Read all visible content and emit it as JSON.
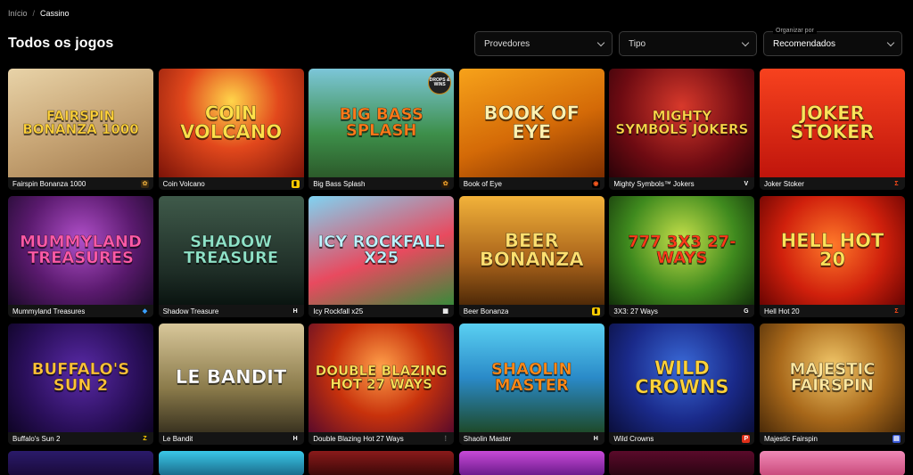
{
  "breadcrumb": {
    "home": "Início",
    "separator": "/",
    "current": "Cassino"
  },
  "page_title": "Todos os jogos",
  "filters": {
    "providers": "Provedores",
    "type": "Tipo",
    "sort_label": "Organizar por",
    "sort_value": "Recomendados"
  },
  "games": [
    {
      "name": "Fairspin Bonanza 1000",
      "logo": "FAIRSPIN BONANZA 1000",
      "bg": "linear-gradient(160deg,#e8d3a8 0%,#c9a777 50%,#a17a4d 100%)",
      "logo_color": "#ffd23a",
      "prov_bg": "#3a2a10",
      "prov_fg": "#d8a03a",
      "prov": "✿"
    },
    {
      "name": "Coin Volcano",
      "logo": "COIN VOLCANO",
      "bg": "radial-gradient(circle at 50% 30%,#ffd54a 0%,#e2481c 45%,#7a1308 100%)",
      "logo_color": "#ffe04a",
      "prov_bg": "#ffcc00",
      "prov_fg": "#000",
      "prov": "▮"
    },
    {
      "name": "Big Bass Splash",
      "logo": "BIG BASS SPLASH",
      "bg": "linear-gradient(180deg,#7cc6d9 0%,#3d8f4a 60%,#2c5a2a 100%)",
      "logo_color": "#ff7a1a",
      "prov_bg": "#2a1a08",
      "prov_fg": "#e39a2b",
      "prov": "✿",
      "badge": "DROPS & WINS"
    },
    {
      "name": "Book of Eye",
      "logo": "BOOK OF EYE",
      "bg": "linear-gradient(160deg,#f7a21a 0%,#d46a07 55%,#7d2d00 100%)",
      "logo_color": "#fff2b0",
      "prov_bg": "#000",
      "prov_fg": "#ff5a1f",
      "prov": "◉"
    },
    {
      "name": "Mighty Symbols™ Jokers",
      "logo": "MIGHTY SYMBOLS JOKERS",
      "bg": "radial-gradient(circle at 50% 35%,#d8392b 0%,#6e0b12 60%,#2a0208 100%)",
      "logo_color": "#ffd84a",
      "prov_bg": "#141414",
      "prov_fg": "#fff",
      "prov": "V"
    },
    {
      "name": "Joker Stoker",
      "logo": "JOKER STOKER",
      "bg": "linear-gradient(180deg,#f7421e 0%,#c0150c 100%)",
      "logo_color": "#ffe45a",
      "prov_bg": "#141414",
      "prov_fg": "#ff4b1a",
      "prov": "Σ"
    },
    {
      "name": "Mummyland Treasures",
      "logo": "MUMMYLAND TREASURES",
      "bg": "radial-gradient(circle at 50% 40%,#b04fc9 0%,#5a1a6e 55%,#1c0a2a 100%)",
      "logo_color": "#ff5aa8",
      "prov_bg": "#141414",
      "prov_fg": "#3aa0ff",
      "prov": "◆"
    },
    {
      "name": "Shadow Treasure",
      "logo": "SHADOW TREASURE",
      "bg": "linear-gradient(180deg,#3f5a4a 0%,#1e2d26 70%,#0a1410 100%)",
      "logo_color": "#8fe3c8",
      "prov_bg": "#141414",
      "prov_fg": "#fff",
      "prov": "H"
    },
    {
      "name": "Icy Rockfall x25",
      "logo": "ICY ROCKFALL X25",
      "bg": "linear-gradient(160deg,#7fd3f2 0%,#e84a5f 55%,#3a8a3a 100%)",
      "logo_color": "#bff3ff",
      "prov_bg": "#141414",
      "prov_fg": "#fff",
      "prov": "▦"
    },
    {
      "name": "Beer Bonanza",
      "logo": "BEER BONANZA",
      "bg": "linear-gradient(180deg,#f2b23a 0%,#a8621a 60%,#4f2a08 100%)",
      "logo_color": "#ffe070",
      "prov_bg": "#ffcc00",
      "prov_fg": "#000",
      "prov": "▮"
    },
    {
      "name": "3X3: 27 Ways",
      "logo": "777 3X3 27-WAYS",
      "bg": "radial-gradient(circle at 50% 40%,#c6e04a 0%,#3f8a1e 55%,#12300a 100%)",
      "logo_color": "#ff3a1a",
      "prov_bg": "#141414",
      "prov_fg": "#fff",
      "prov": "G"
    },
    {
      "name": "Hell Hot 20",
      "logo": "HELL HOT 20",
      "bg": "radial-gradient(circle at 50% 45%,#ff7a2a 0%,#d0200c 55%,#6a0402 100%)",
      "logo_color": "#ffe45a",
      "prov_bg": "#141414",
      "prov_fg": "#ff4b1a",
      "prov": "Σ"
    },
    {
      "name": "Buffalo's Sun 2",
      "logo": "BUFFALO'S SUN 2",
      "bg": "radial-gradient(circle at 50% 45%,#5a2aa8 0%,#2a0f5a 60%,#0e0424 100%)",
      "logo_color": "#ffc23a",
      "prov_bg": "#141414",
      "prov_fg": "#ffcc00",
      "prov": "Z"
    },
    {
      "name": "Le Bandit",
      "logo": "LE BANDIT",
      "bg": "linear-gradient(180deg,#d8c79a 0%,#8a7a4a 60%,#3a3320 100%)",
      "logo_color": "#ffffff",
      "prov_bg": "#141414",
      "prov_fg": "#fff",
      "prov": "H"
    },
    {
      "name": "Double Blazing Hot 27 Ways",
      "logo": "DOUBLE BLAZING HOT 27 WAYS",
      "bg": "radial-gradient(circle at 50% 40%,#ffa04a 0%,#c8320c 50%,#5a0a2a 100%)",
      "logo_color": "#ffe45a",
      "prov_bg": "#141414",
      "prov_fg": "#888",
      "prov": "⋮"
    },
    {
      "name": "Shaolin Master",
      "logo": "SHAOLIN MASTER",
      "bg": "linear-gradient(180deg,#5ad0f2 0%,#2a8ac8 50%,#1e4a2a 100%)",
      "logo_color": "#ff8a1a",
      "prov_bg": "#141414",
      "prov_fg": "#fff",
      "prov": "H"
    },
    {
      "name": "Wild Crowns",
      "logo": "WILD CROWNS",
      "bg": "radial-gradient(circle at 50% 40%,#3a6ad8 0%,#1a2a8a 55%,#0a0e3a 100%)",
      "logo_color": "#ffd23a",
      "prov_bg": "#e0301a",
      "prov_fg": "#fff",
      "prov": "P"
    },
    {
      "name": "Majestic Fairspin",
      "logo": "MAJESTIC FAIRSPIN",
      "bg": "radial-gradient(circle at 50% 40%,#f2c86a 0%,#a8681a 55%,#4a2a08 100%)",
      "logo_color": "#ffe8a0",
      "prov_bg": "#3a5ad8",
      "prov_fg": "#fff",
      "prov": "▤"
    }
  ],
  "partial_row": [
    {
      "bg": "linear-gradient(180deg,#2a1a6a,#1a0a3a)"
    },
    {
      "bg": "linear-gradient(180deg,#3ac8e8,#1a6a8a)"
    },
    {
      "bg": "linear-gradient(180deg,#8a1a1a,#3a0808)"
    },
    {
      "bg": "linear-gradient(180deg,#c84ad8,#6a1a8a)"
    },
    {
      "bg": "linear-gradient(180deg,#5a0a2a,#2a0412)"
    },
    {
      "bg": "linear-gradient(180deg,#f28ab8,#c84a7a)"
    }
  ]
}
